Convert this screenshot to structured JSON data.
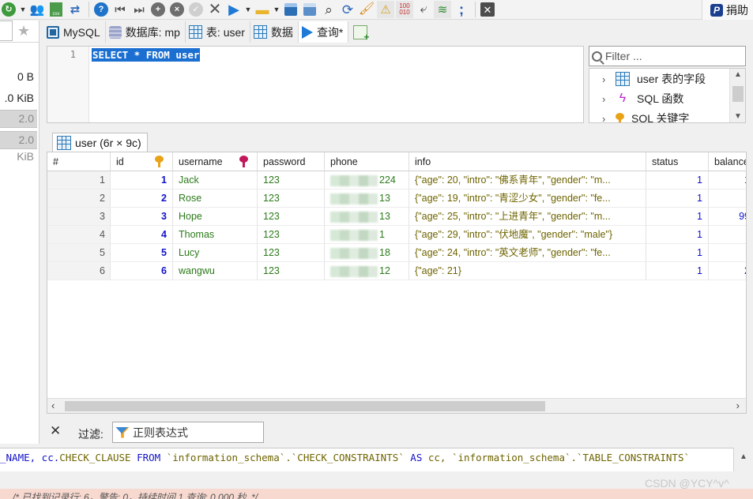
{
  "toolbar": {
    "icons": [
      "refresh-icon",
      "dropdown-arrow",
      "users-icon",
      "csv-export-icon",
      "transfer-icon",
      "help-icon",
      "first-record-icon",
      "last-record-icon",
      "add-record-icon",
      "delete-record-icon",
      "apply-icon",
      "cancel-icon",
      "run-icon",
      "dropdown-arrow",
      "folder-icon",
      "dropdown-arrow",
      "save-icon",
      "save-as-icon",
      "find-icon",
      "find-replace-icon",
      "clean-icon",
      "warning-icon",
      "binary-icon",
      "wrap-icon",
      "line-numbers-icon",
      "semicolon-icon",
      "close-icon"
    ],
    "donate_label": "捐助"
  },
  "left_panel": {
    "sizes": [
      "0 B",
      ".0 KiB",
      "2.0 KiB",
      "2.0 KiB"
    ]
  },
  "tabs": [
    {
      "label": "MySQL",
      "icon": "connection-icon"
    },
    {
      "label": "数据库: mp",
      "icon": "database-icon"
    },
    {
      "label": "表: user",
      "icon": "table-icon"
    },
    {
      "label": "数据",
      "icon": "data-grid-icon"
    },
    {
      "label": "查询*",
      "icon": "query-play-icon"
    }
  ],
  "editor": {
    "line_number": "1",
    "sql": "SELECT * FROM user"
  },
  "helper": {
    "filter_placeholder": "Filter ...",
    "items": [
      "user 表的字段",
      "SQL 函数",
      "SQL 关键字"
    ]
  },
  "result": {
    "tab_label": "user (6r × 9c)",
    "columns": [
      "#",
      "id",
      "username",
      "password",
      "phone",
      "info",
      "status",
      "balance"
    ],
    "rows": [
      {
        "n": "1",
        "id": "1",
        "username": "Jack",
        "password": "123",
        "phone": "224",
        "info": "{\"age\": 20, \"intro\": \"佛系青年\", \"gender\": \"m...",
        "status": "1",
        "balance": "1"
      },
      {
        "n": "2",
        "id": "2",
        "username": "Rose",
        "password": "123",
        "phone": "13",
        "info": "{\"age\": 19, \"intro\": \"青涩少女\", \"gender\": \"fe...",
        "status": "1",
        "balance": ""
      },
      {
        "n": "3",
        "id": "3",
        "username": "Hope",
        "password": "123",
        "phone": "13",
        "info": "{\"age\": 25, \"intro\": \"上进青年\", \"gender\": \"m...",
        "status": "1",
        "balance": "99"
      },
      {
        "n": "4",
        "id": "4",
        "username": "Thomas",
        "password": "123",
        "phone": "1",
        "info": "{\"age\": 29, \"intro\": \"伏地魔\", \"gender\": \"male\"}",
        "status": "1",
        "balance": ""
      },
      {
        "n": "5",
        "id": "5",
        "username": "Lucy",
        "password": "123",
        "phone": "18",
        "info": "{\"age\": 24, \"intro\": \"英文老师\", \"gender\": \"fe...",
        "status": "1",
        "balance": ""
      },
      {
        "n": "6",
        "id": "6",
        "username": "wangwu",
        "password": "123",
        "phone": "12",
        "info": "{\"age\": 21}",
        "status": "1",
        "balance": "2"
      }
    ]
  },
  "filter_bar": {
    "label": "过滤:",
    "placeholder": "正则表达式"
  },
  "log": {
    "prefix": "_NAME, cc.",
    "p1": "CHECK_CLAUSE ",
    "kw1": "FROM",
    "p2": " `information_schema`.`CHECK_CONSTRAINTS` ",
    "kw2": "AS",
    "p3": " cc, `information_schema`.`TABLE_CONSTRAINTS`",
    "status": "/* 已找到记录行: 6，警告: 0，持续时间 1 查询: 0.000 秒. */"
  },
  "watermark": "CSDN @YCY^v^"
}
